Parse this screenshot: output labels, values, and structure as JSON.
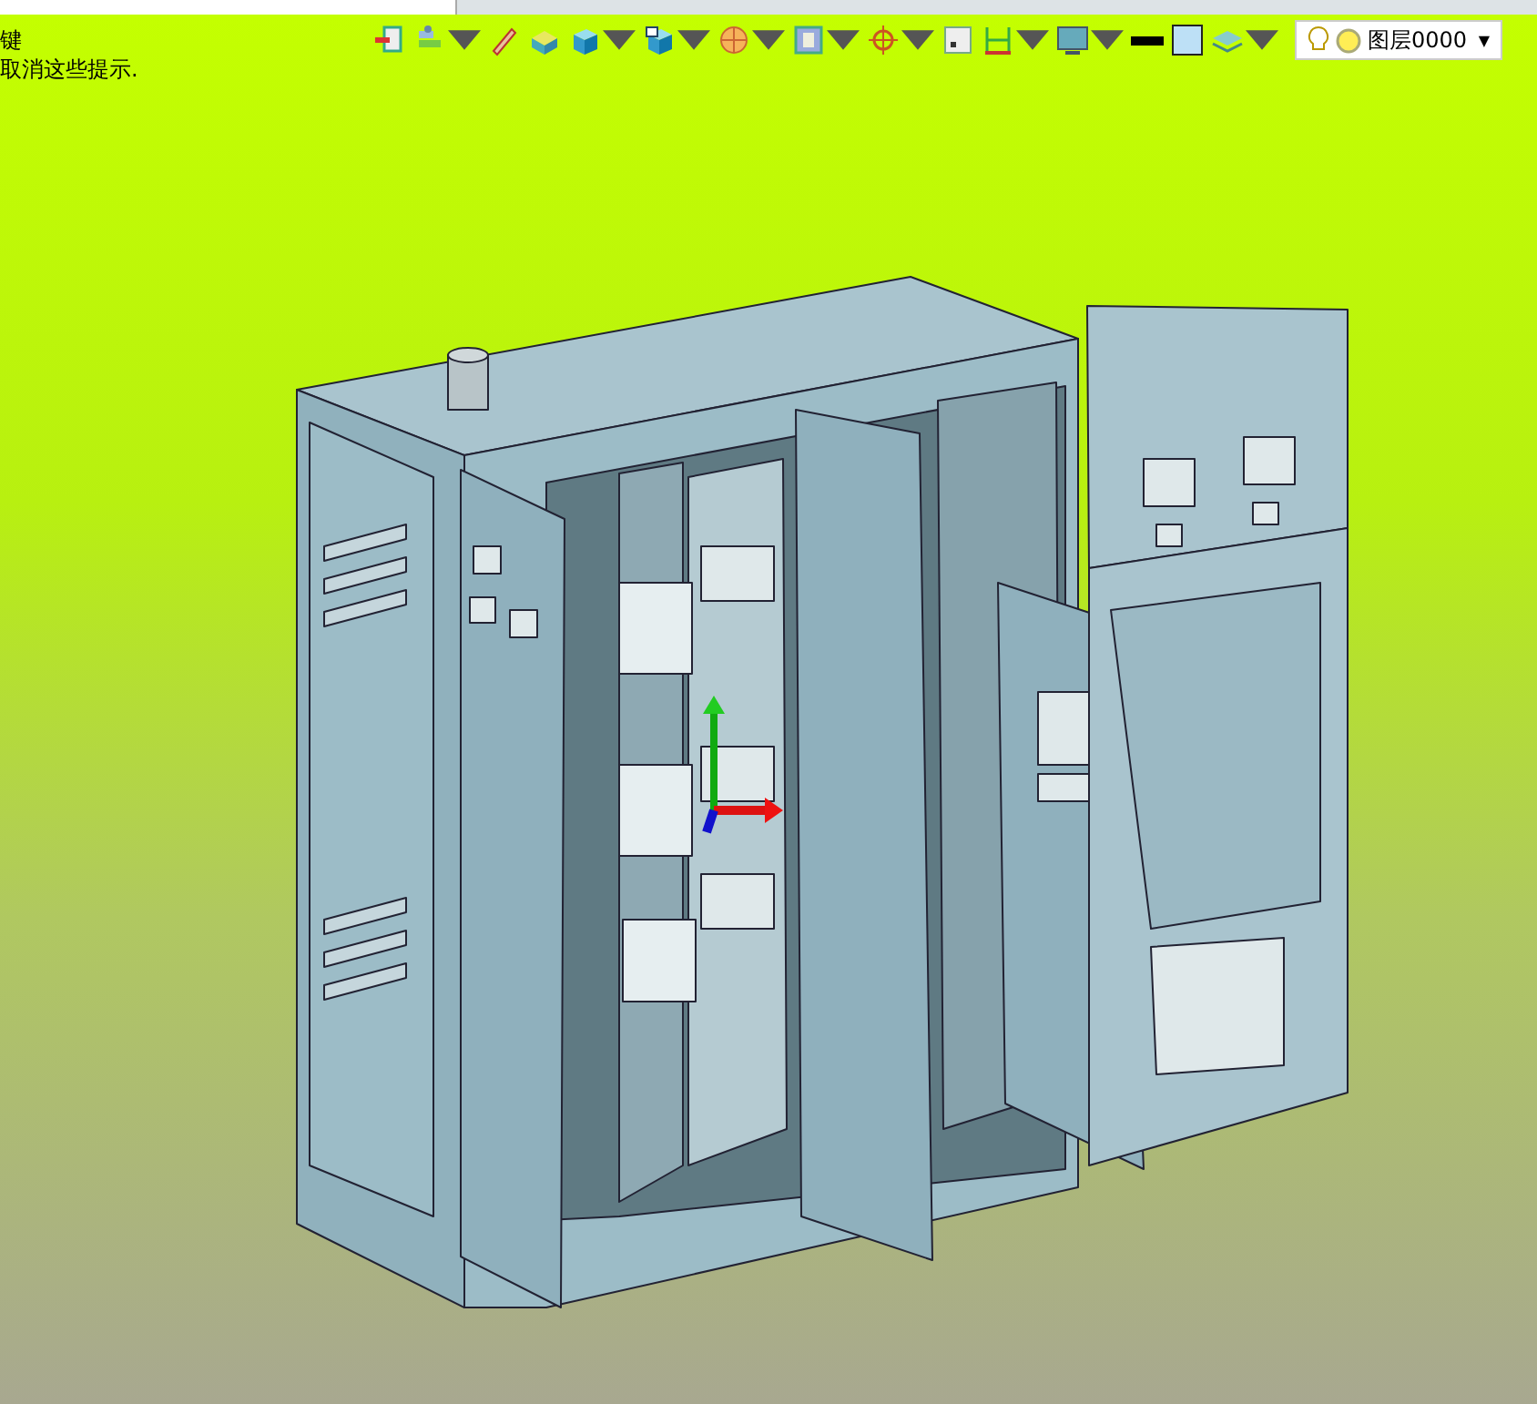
{
  "hints": [
    "键",
    "取消这些提示."
  ],
  "toolbar": [
    {
      "dropdown": false
    },
    {
      "dropdown": true
    },
    {
      "dropdown": false
    },
    {
      "dropdown": false
    },
    {
      "dropdown": true
    },
    {
      "dropdown": true
    },
    {
      "dropdown": true
    },
    {
      "dropdown": true
    },
    {
      "dropdown": true
    },
    {
      "dropdown": false
    },
    {
      "dropdown": true
    },
    {
      "dropdown": true
    },
    {
      "dropdown": false
    },
    {
      "dropdown": false
    },
    {
      "dropdown": true
    }
  ],
  "layer_selector": {
    "value": "图层0000",
    "caret": "▼"
  }
}
